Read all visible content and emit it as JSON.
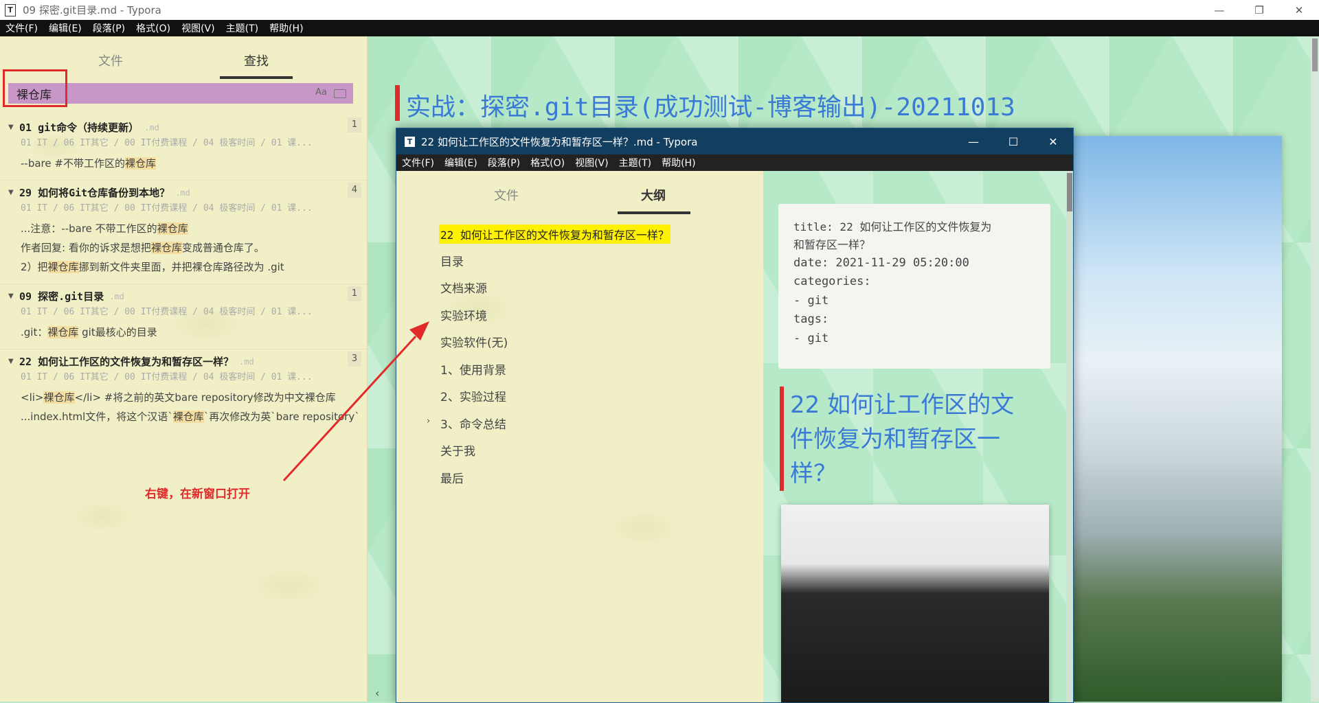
{
  "window": {
    "app_icon": "T",
    "title": "09 探密.git目录.md - Typora",
    "controls": [
      "—",
      "❐",
      "✕"
    ]
  },
  "menu": [
    "文件(F)",
    "编辑(E)",
    "段落(P)",
    "格式(O)",
    "视图(V)",
    "主题(T)",
    "帮助(H)"
  ],
  "sidebar": {
    "tabs": [
      {
        "label": "文件",
        "active": false
      },
      {
        "label": "查找",
        "active": true
      }
    ],
    "search": {
      "value": "裸仓库",
      "case_option": "Aa"
    },
    "results": [
      {
        "title": "01 git命令（持续更新）",
        "ext": ".md",
        "count": "1",
        "path": "01 IT / 06 IT其它 / 00 IT付费课程 / 04 极客时间 / 01 课...",
        "lines": [
          {
            "pre": "--bare #不带工作区的",
            "hl": "裸仓库",
            "post": ""
          }
        ]
      },
      {
        "title": "29 如何将Git仓库备份到本地？",
        "ext": ".md",
        "count": "4",
        "path": "01 IT / 06 IT其它 / 00 IT付费课程 / 04 极客时间 / 01 课...",
        "lines": [
          {
            "pre": "...注意：--bare 不带工作区的",
            "hl": "裸仓库",
            "post": ""
          },
          {
            "pre": "作者回复: 看你的诉求是想把",
            "hl": "裸仓库",
            "post": "变成普通仓库了。"
          },
          {
            "pre": "2）把",
            "hl": "裸仓库",
            "post": "挪到新文件夹里面，并把裸仓库路径改为 .git"
          }
        ]
      },
      {
        "title": "09 探密.git目录",
        "ext": ".md",
        "count": "1",
        "path": "01 IT / 06 IT其它 / 00 IT付费课程 / 04 极客时间 / 01 课...",
        "lines": [
          {
            "pre": ".git：",
            "hl": "裸仓库",
            "post": " git最核心的目录"
          }
        ]
      },
      {
        "title": "22 如何让工作区的文件恢复为和暂存区一样？",
        "ext": ".md",
        "count": "3",
        "path": "01 IT / 06 IT其它 / 00 IT付费课程 / 04 极客时间 / 01 课...",
        "lines": [
          {
            "pre": "<li>",
            "hl": "裸仓库",
            "post": "</li> #将之前的英文bare repository修改为中文裸仓库"
          },
          {
            "pre": "...index.html文件，将这个汉语`",
            "hl": "裸仓库",
            "post": "`再次修改为英`bare repository`"
          }
        ]
      }
    ],
    "annotation": "右键，在新窗口打开"
  },
  "editor": {
    "heading": "实战：探密.git目录(成功测试-博客输出)-20211013"
  },
  "window2": {
    "app_icon": "T",
    "title": "22 如何让工作区的文件恢复为和暂存区一样？.md - Typora",
    "controls": [
      "—",
      "☐",
      "✕"
    ],
    "menu": [
      "文件(F)",
      "编辑(E)",
      "段落(P)",
      "格式(O)",
      "视图(V)",
      "主题(T)",
      "帮助(H)"
    ],
    "tabs": [
      {
        "label": "文件",
        "active": false
      },
      {
        "label": "大纲",
        "active": true
      }
    ],
    "outline": [
      {
        "label": "22 如何让工作区的文件恢复为和暂存区一样？",
        "active": true
      },
      {
        "label": "目录"
      },
      {
        "label": "文档来源"
      },
      {
        "label": "实验环境"
      },
      {
        "label": "实验软件(无)"
      },
      {
        "label": "1、使用背景"
      },
      {
        "label": "2、实验过程"
      },
      {
        "label": "3、命令总结",
        "collapsible": true
      },
      {
        "label": "关于我"
      },
      {
        "label": "最后"
      }
    ],
    "front_matter": [
      "title: 22 如何让工作区的文件恢复为",
      "和暂存区一样？",
      "date: 2021-11-29 05:20:00",
      "categories:",
      "- git",
      "tags:",
      "- git"
    ],
    "heading": "22 如何让工作区的文件恢复为和暂存区一样？"
  }
}
